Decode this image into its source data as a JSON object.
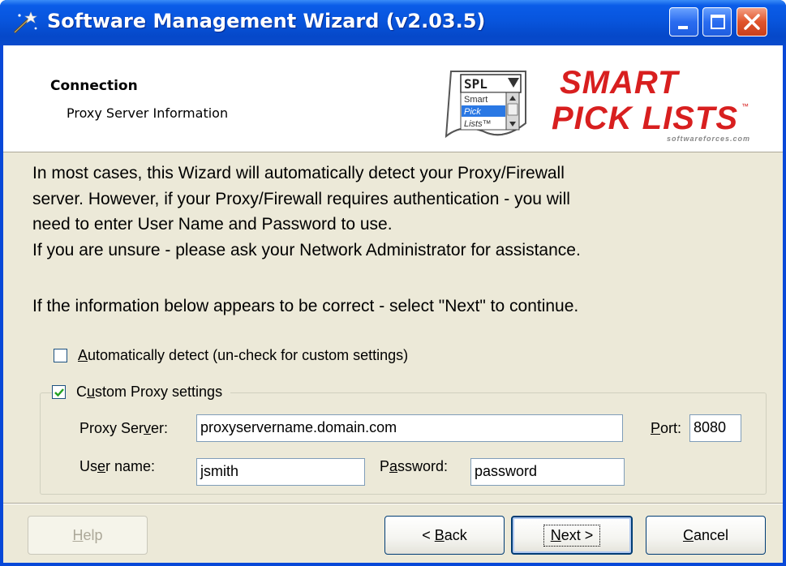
{
  "window": {
    "title": "Software Management Wizard (v2.03.5)"
  },
  "header": {
    "title": "Connection",
    "subtitle": "Proxy Server Information",
    "logo_spl": "SPL",
    "logo_menu": [
      "Smart",
      "Pick",
      "Lists™"
    ],
    "logo_line1": "SMART",
    "logo_line2": "PICK LISTS",
    "logo_tm": "™",
    "logo_domain": "softwareforces.com"
  },
  "body": {
    "lines": [
      "In most cases, this Wizard will automatically detect your Proxy/Firewall",
      "server. However, if your Proxy/Firewall requires authentication - you will",
      "need to enter User Name and Password to use.",
      "If you are unsure - please ask your Network Administrator for assistance.",
      "If the information below appears to be correct - select \"Next\"  to continue."
    ]
  },
  "options": {
    "auto_detect": {
      "label_u": "A",
      "label_rest": "utomatically detect (un-check for custom settings)",
      "checked": false
    },
    "custom_proxy": {
      "label_pre": "C",
      "label_u": "u",
      "label_rest": "stom Proxy settings",
      "checked": true
    }
  },
  "fields": {
    "proxy_server": {
      "label_pre": "Proxy Ser",
      "label_u": "v",
      "label_rest": "er:",
      "value": "proxyservername.domain.com"
    },
    "port": {
      "label_u": "P",
      "label_rest": "ort:",
      "value": "8080"
    },
    "username": {
      "label_pre": "Us",
      "label_u": "e",
      "label_rest": "r name:",
      "value": "jsmith"
    },
    "password": {
      "label_pre": "P",
      "label_u": "a",
      "label_rest": "ssword:",
      "value": "password"
    }
  },
  "buttons": {
    "help": {
      "u": "H",
      "rest": "elp",
      "enabled": false
    },
    "back": {
      "pre": "< ",
      "u": "B",
      "rest": "ack"
    },
    "next": {
      "u": "N",
      "rest": "ext >"
    },
    "cancel": {
      "u": "C",
      "rest": "ancel"
    }
  },
  "colors": {
    "titlebar": "#0a5ce8",
    "client": "#ece9d8",
    "logo_red": "#d81f1f",
    "close_button": "#e0542c"
  }
}
